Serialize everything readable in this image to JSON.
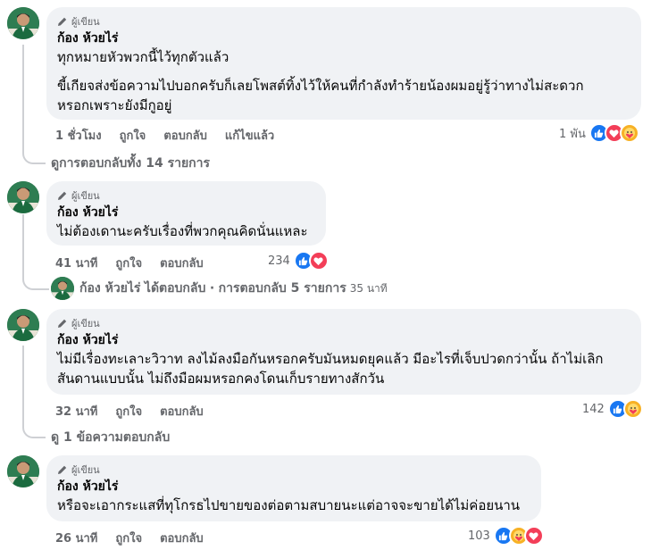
{
  "comments": [
    {
      "badge": "ผู้เขียน",
      "author": "ก้อง ห้วยไร่",
      "lines": [
        "ทุกหมายหัวพวกนี้ไว้ทุกตัวแล้ว",
        "ขี้เกียจส่งข้อความไปบอกครับก็เลยโพสต์ทิ้งไว้ให้คนที่กำลังทำร้ายน้องผมอยู่รู้ว่าทางไม่สะดวก\nหรอกเพราะยังมีกูอยู่"
      ],
      "time": "1 ชั่วโมง",
      "like": "ถูกใจ",
      "reply": "ตอบกลับ",
      "edited": "แก้ไขแล้ว",
      "reaction_count": "1 พัน",
      "reactions": [
        "like-icon",
        "love-icon",
        "care-icon"
      ]
    },
    {
      "badge": "ผู้เขียน",
      "author": "ก้อง ห้วยไร่",
      "lines": [
        "ไม่ต้องเดานะครับเรื่องที่พวกคุณคิดนั่นแหละ"
      ],
      "time": "41 นาที",
      "like": "ถูกใจ",
      "reply": "ตอบกลับ",
      "reaction_count": "234",
      "reactions": [
        "like-icon",
        "love-icon"
      ]
    },
    {
      "badge": "ผู้เขียน",
      "author": "ก้อง ห้วยไร่",
      "lines": [
        "ไม่มีเรื่องทะเลาะวิวาท ลงไม้ลงมือกันหรอกครับมันหมดยุคแล้ว มีอะไรที่เจ็บปวดกว่านั้น ถ้าไม่เลิก\nสันดานแบบนั้น ไม่ถึงมือผมหรอกคงโดนเก็บรายทางสักวัน"
      ],
      "time": "32 นาที",
      "like": "ถูกใจ",
      "reply": "ตอบกลับ",
      "reaction_count": "142",
      "reactions": [
        "like-icon",
        "care-icon"
      ]
    },
    {
      "badge": "ผู้เขียน",
      "author": "ก้อง ห้วยไร่",
      "lines": [
        "หรือจะเอากระแสที่ทุโกรธไปขายของต่อตามสบายนะแต่อาจจะขายได้ไม่ค่อยนาน"
      ],
      "time": "26 นาที",
      "like": "ถูกใจ",
      "reply": "ตอบกลับ",
      "reaction_count": "103",
      "reactions": [
        "like-icon",
        "care-icon",
        "love-icon"
      ]
    }
  ],
  "view_all_replies": "ดูการตอบกลับทั้ง 14 รายการ",
  "reply_summary": {
    "name": "ก้อง ห้วยไร่",
    "action": "ได้ตอบกลับ",
    "separator": "·",
    "count": "การตอบกลับ 5 รายการ",
    "time": "35 นาที"
  },
  "view_one_reply": "ดู 1 ข้อความตอบกลับ",
  "colors": {
    "bubble": "#f0f2f5",
    "meta_text": "#65676b",
    "like": "#1877f2",
    "love": "#f33e58",
    "care": "#f7b125",
    "avatar_bg": "#1f5d3a"
  }
}
